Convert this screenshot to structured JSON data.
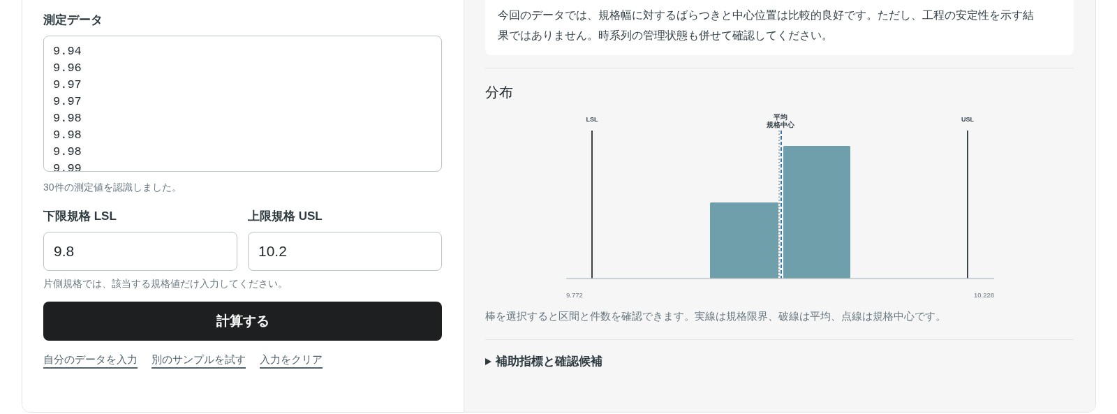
{
  "input_panel": {
    "data_label": "測定データ",
    "data_values": "9.94\n9.96\n9.97\n9.97\n9.98\n9.98\n9.98\n9.99",
    "data_status": "30件の測定値を認識しました。",
    "lsl": {
      "label": "下限規格 LSL",
      "value": "9.8"
    },
    "usl": {
      "label": "上限規格 USL",
      "value": "10.2"
    },
    "spec_hint": "片側規格では、該当する規格値だけ入力してください。",
    "calculate_button": "計算する",
    "links": [
      "自分のデータを入力",
      "別のサンプルを試す",
      "入力をクリア"
    ]
  },
  "result_panel": {
    "summary": "今回のデータでは、規格幅に対するばらつきと中心位置は比較的良好です。ただし、工程の安定性を示す結果ではありません。時系列の管理状態も併せて確認してください。",
    "distribution_title": "分布",
    "histogram": {
      "lsl_label": "LSL",
      "usl_label": "USL",
      "mean_label": "平均",
      "center_label": "規格中心",
      "x_min_label": "9.772",
      "x_max_label": "10.228"
    },
    "caption": "棒を選択すると区間と件数を確認できます。実線は規格限界、破線は平均、点線は規格中心です。",
    "details": {
      "label": "補助指標と確認候補",
      "expanded": false
    }
  }
}
